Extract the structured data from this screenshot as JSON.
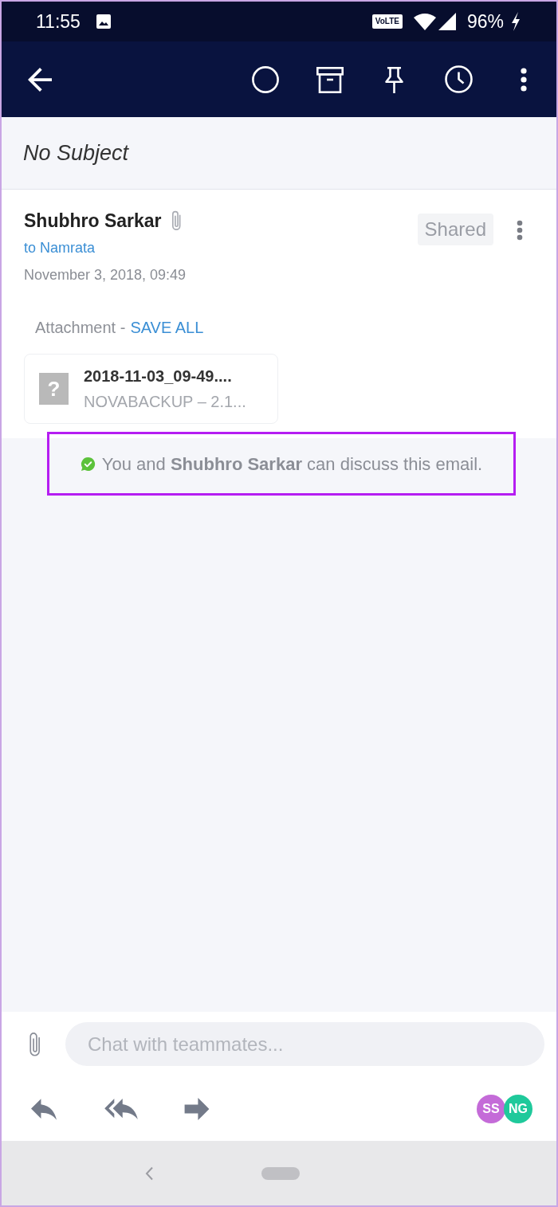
{
  "status_bar": {
    "time": "11:55",
    "network_badge": "VoLTE",
    "battery": "96%"
  },
  "subject": "No Subject",
  "message": {
    "sender": "Shubhro Sarkar",
    "tag": "Shared",
    "recipient": "to Namrata",
    "date": "November 3, 2018, 09:49"
  },
  "attachments": {
    "label": "Attachment -",
    "save_all": "SAVE ALL",
    "files": [
      {
        "type_glyph": "?",
        "name": "2018-11-03_09-49....",
        "detail": "NOVABACKUP – 2.1..."
      }
    ]
  },
  "discussion_note": "You and **Shubhro Sarkar** can discuss this email.",
  "composer": {
    "placeholder": "Chat with teammates..."
  },
  "participants": [
    {
      "initials": "SS",
      "color": "#c46bd8"
    },
    {
      "initials": "NG",
      "color": "#1fc99b"
    }
  ]
}
